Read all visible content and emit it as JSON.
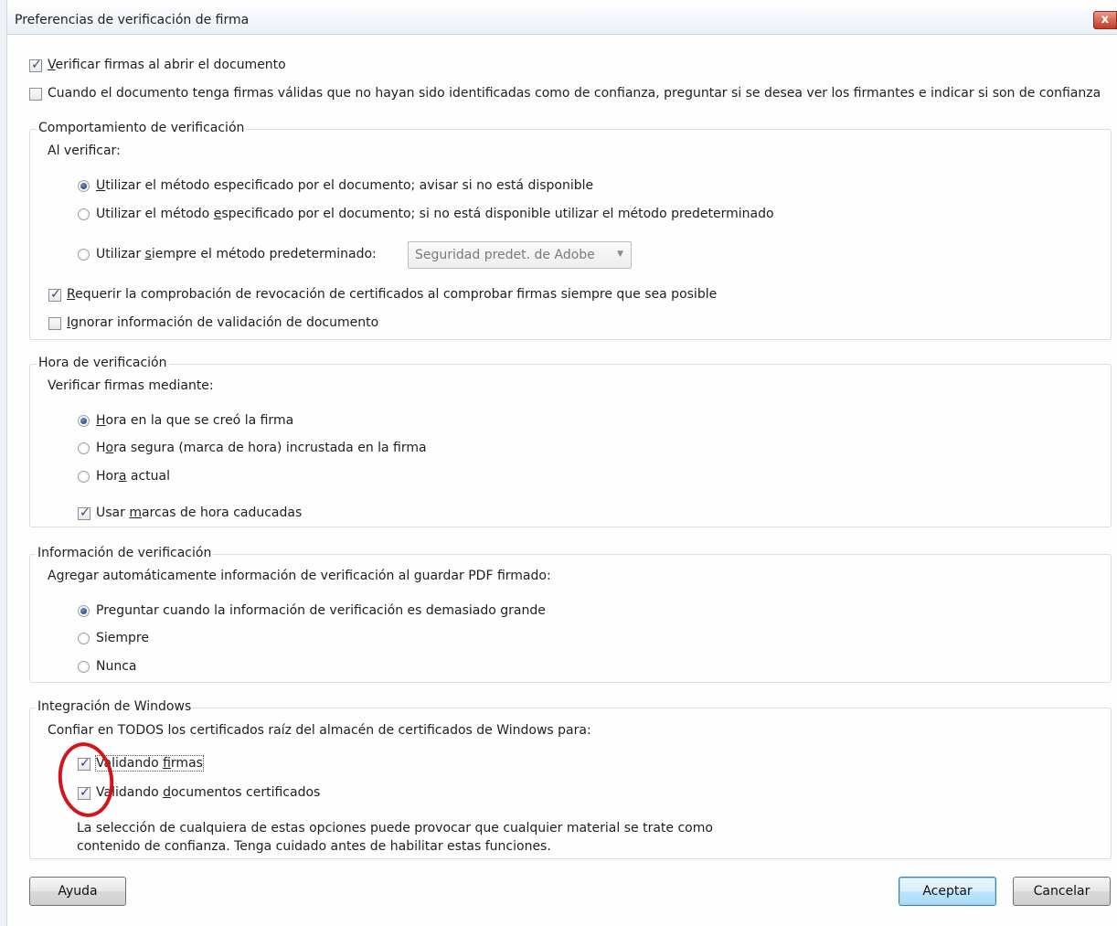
{
  "window": {
    "title": "Preferencias de verificación de firma",
    "close_label": "x"
  },
  "top_options": {
    "verify_on_open": {
      "pre": "",
      "ul": "V",
      "post": "erificar firmas al abrir el documento",
      "checked": true
    },
    "ask_untrusted": {
      "label": "Cuando el documento tenga firmas válidas que no hayan sido identificadas como de confianza, preguntar si se desea ver los firmantes e indicar si son de confianza",
      "checked": false
    }
  },
  "verification_behavior": {
    "title": "Comportamiento de verificación",
    "prompt": "Al verificar:",
    "option1": {
      "pre": "",
      "ul": "U",
      "post": "tilizar el método especificado por el documento; avisar si no está disponible",
      "selected": true
    },
    "option2": {
      "pre": "Utilizar el método ",
      "ul": "e",
      "post": "specificado por el documento; si no está disponible utilizar el método predeterminado",
      "selected": false
    },
    "option3": {
      "pre": "Utilizar ",
      "ul": "s",
      "post": "iempre el método predeterminado:",
      "selected": false
    },
    "default_method": "Seguridad predet. de Adobe",
    "require_revocation": {
      "pre": "",
      "ul": "R",
      "post": "equerir la comprobación de revocación de certificados al comprobar firmas siempre que sea posible",
      "checked": true
    },
    "ignore_validation": {
      "pre": "",
      "ul": "I",
      "post": "gnorar información de validación de documento",
      "checked": false
    }
  },
  "verification_time": {
    "title": "Hora de verificación",
    "prompt": "Verificar firmas mediante:",
    "option1": {
      "pre": "",
      "ul": "H",
      "post": "ora en la que se creó la firma",
      "selected": true
    },
    "option2": {
      "pre": "H",
      "ul": "o",
      "post": "ra segura (marca de hora) incrustada en la firma",
      "selected": false
    },
    "option3": {
      "pre": "Hor",
      "ul": "a",
      "post": " actual",
      "selected": false
    },
    "use_expired": {
      "pre": "Usar ",
      "ul": "m",
      "post": "arcas de hora caducadas",
      "checked": true
    }
  },
  "verification_info": {
    "title": "Información de verificación",
    "prompt": "Agregar automáticamente información de verificación al guardar PDF firmado:",
    "option1": {
      "label": "Preguntar cuando la información de verificación es demasiado grande",
      "selected": true
    },
    "option2": {
      "label": "Siempre",
      "selected": false
    },
    "option3": {
      "label": "Nunca",
      "selected": false
    }
  },
  "windows_integration": {
    "title": "Integración de Windows",
    "prompt": "Confiar en TODOS los certificados raíz del almacén de certificados de Windows para:",
    "validating_signatures": {
      "pre": "Validando ",
      "ul": "f",
      "post": "irmas",
      "checked": true
    },
    "validating_certified": {
      "pre": "Validando ",
      "ul": "d",
      "post": "ocumentos certificados",
      "checked": true
    },
    "warning_line1": "La selección de cualquiera de estas opciones puede provocar que cualquier material se trate como",
    "warning_line2": "contenido de confianza. Tenga cuidado antes de habilitar estas funciones."
  },
  "buttons": {
    "help": "Ayuda",
    "accept": "Aceptar",
    "cancel": "Cancelar"
  },
  "colors": {
    "annotation": "#d4141a",
    "accent": "#27457a"
  }
}
